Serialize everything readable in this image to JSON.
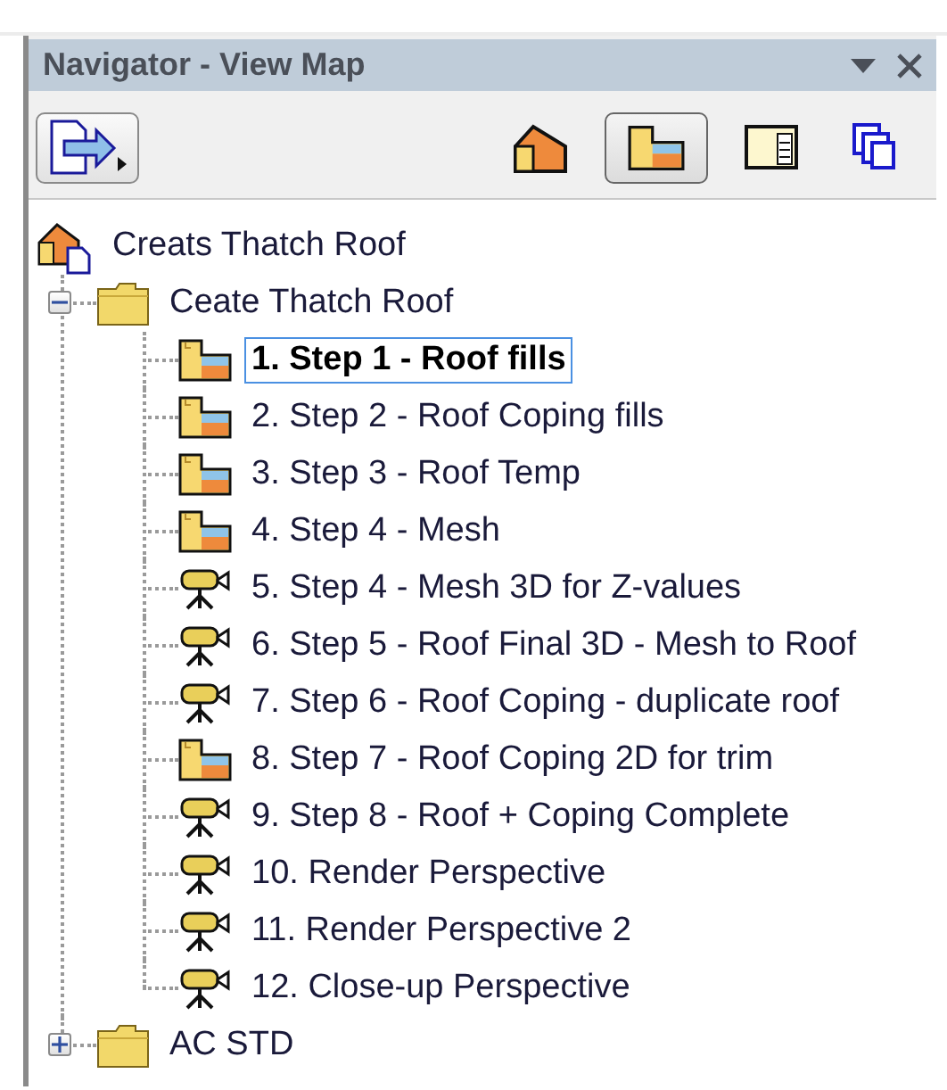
{
  "panel": {
    "title": "Navigator - View Map"
  },
  "toolbar": {
    "buttons": [
      {
        "kind": "publish",
        "selected": false
      },
      {
        "kind": "project",
        "selected": false
      },
      {
        "kind": "view",
        "selected": true
      },
      {
        "kind": "layout",
        "selected": false
      },
      {
        "kind": "publisher",
        "selected": false
      }
    ]
  },
  "tree": {
    "label": "Creats Thatch Roof",
    "kind": "root",
    "selected": false,
    "children": [
      {
        "label": "Ceate Thatch Roof",
        "kind": "folder",
        "expanded": true,
        "selected": false,
        "children": [
          {
            "label": "1. Step 1 - Roof fills",
            "kind": "plan",
            "selected": true
          },
          {
            "label": "2. Step 2 - Roof Coping fills",
            "kind": "plan",
            "selected": false
          },
          {
            "label": "3. Step 3 - Roof Temp",
            "kind": "plan",
            "selected": false
          },
          {
            "label": "4. Step 4 - Mesh",
            "kind": "plan",
            "selected": false
          },
          {
            "label": "5. Step 4 - Mesh 3D for Z-values",
            "kind": "camera",
            "selected": false
          },
          {
            "label": "6. Step 5 - Roof Final 3D - Mesh to Roof",
            "kind": "camera",
            "selected": false
          },
          {
            "label": "7. Step 6 - Roof Coping - duplicate roof",
            "kind": "camera",
            "selected": false
          },
          {
            "label": "8. Step 7 - Roof Coping 2D for trim",
            "kind": "plan",
            "selected": false
          },
          {
            "label": "9. Step 8 - Roof + Coping Complete",
            "kind": "camera",
            "selected": false
          },
          {
            "label": "10. Render Perspective",
            "kind": "camera",
            "selected": false
          },
          {
            "label": "11. Render Perspective 2",
            "kind": "camera",
            "selected": false
          },
          {
            "label": "12. Close-up Perspective",
            "kind": "camera",
            "selected": false
          }
        ]
      },
      {
        "label": "AC STD",
        "kind": "folder",
        "expanded": false,
        "selected": false
      }
    ]
  }
}
